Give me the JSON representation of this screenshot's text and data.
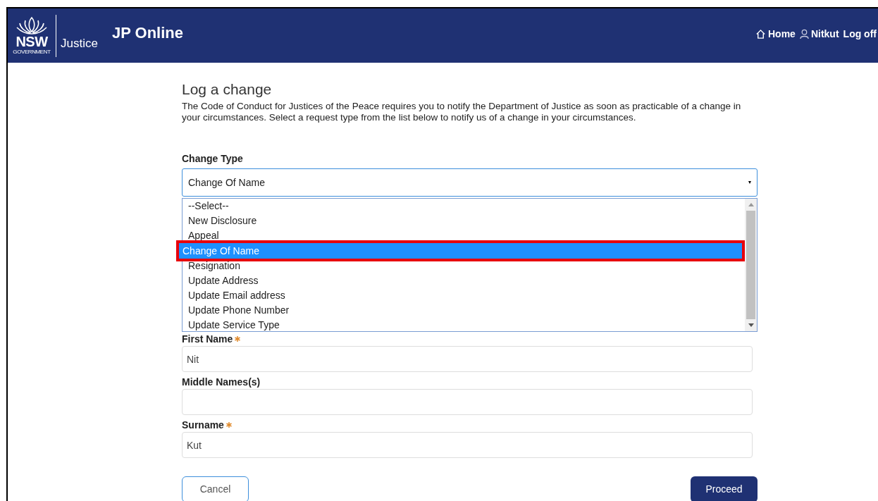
{
  "header": {
    "logo": {
      "line1": "NSW",
      "line2": "GOVERNMENT",
      "department": "Justice"
    },
    "title": "JP Online",
    "nav": [
      {
        "kind": "home",
        "label": "Home"
      },
      {
        "kind": "user",
        "label": "Nitkut"
      },
      {
        "kind": "plain",
        "label": "Log off"
      }
    ]
  },
  "page": {
    "heading": "Log a change",
    "intro": "The Code of Conduct for Justices of the Peace requires you to notify the Department of Justice as soon as practicable of a change in your circumstances. Select a request type from the list below to notify us of a change in your circumstances."
  },
  "change_type": {
    "label": "Change Type",
    "value": "Change Of Name",
    "expanded": true,
    "options": [
      {
        "label": "--Select--",
        "selected": false
      },
      {
        "label": "New Disclosure",
        "selected": false
      },
      {
        "label": "Appeal",
        "selected": false
      },
      {
        "label": "Change Of Name",
        "selected": true
      },
      {
        "label": "Resignation",
        "selected": false
      },
      {
        "label": "Update Address",
        "selected": false
      },
      {
        "label": "Update Email address",
        "selected": false
      },
      {
        "label": "Update Phone Number",
        "selected": false
      },
      {
        "label": "Update Service Type",
        "selected": false
      }
    ]
  },
  "fields": [
    {
      "label": "First Name",
      "required": true,
      "value": "Nit"
    },
    {
      "label": "Middle Names(s)",
      "required": false
    },
    {
      "label": "Surname",
      "required": true,
      "value": "Kut"
    }
  ],
  "buttons": [
    {
      "kind": "secondary",
      "label": "Cancel"
    },
    {
      "kind": "primary",
      "label": "Proceed"
    }
  ]
}
